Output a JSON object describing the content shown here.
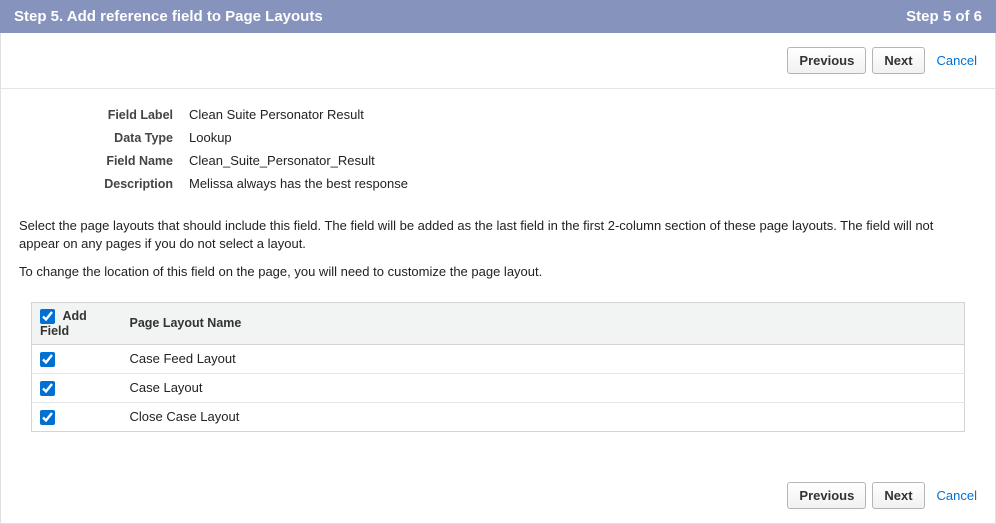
{
  "header": {
    "title": "Step 5. Add reference field to Page Layouts",
    "step_indicator": "Step 5 of 6"
  },
  "buttons": {
    "previous": "Previous",
    "next": "Next",
    "cancel": "Cancel"
  },
  "fields": {
    "field_label_label": "Field Label",
    "field_label_value": "Clean Suite Personator Result",
    "data_type_label": "Data Type",
    "data_type_value": "Lookup",
    "field_name_label": "Field Name",
    "field_name_value": "Clean_Suite_Personator_Result",
    "description_label": "Description",
    "description_value": "Melissa always has the best response"
  },
  "instructions": {
    "p1": "Select the page layouts that should include this field. The field will be added as the last field in the first 2-column section of these page layouts. The field will not appear on any pages if you do not select a layout.",
    "p2": "To change the location of this field on the page, you will need to customize the page layout."
  },
  "table": {
    "header_add": "Add Field",
    "header_name": "Page Layout Name",
    "rows": [
      {
        "name": "Case Feed Layout"
      },
      {
        "name": "Case Layout"
      },
      {
        "name": "Close Case Layout"
      }
    ]
  }
}
